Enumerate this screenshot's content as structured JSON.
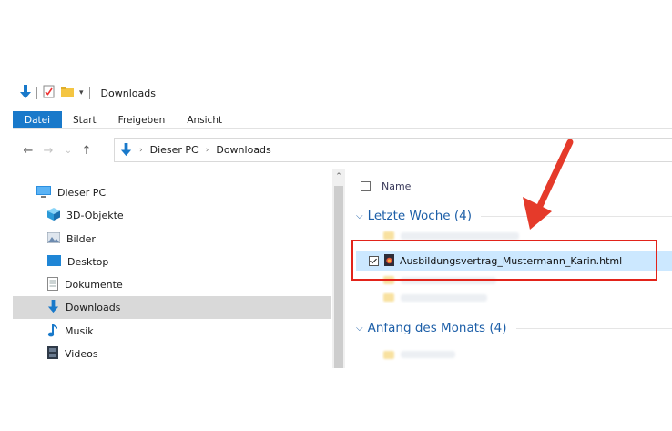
{
  "window": {
    "title": "Downloads"
  },
  "quick_access": {
    "icons": [
      "arrow-down-icon",
      "properties-icon",
      "new-folder-icon",
      "customize-dropdown-icon"
    ]
  },
  "ribbon": {
    "tabs": [
      {
        "label": "Datei",
        "active": true
      },
      {
        "label": "Start"
      },
      {
        "label": "Freigeben"
      },
      {
        "label": "Ansicht"
      }
    ]
  },
  "nav": {
    "back": "←",
    "forward": "→",
    "recent": "⌄",
    "up": "↑"
  },
  "address": {
    "crumbs": [
      "Dieser PC",
      "Downloads"
    ]
  },
  "sidebar": {
    "items": [
      {
        "label": "Dieser PC",
        "icon": "pc-icon"
      },
      {
        "label": "3D-Objekte",
        "icon": "cube-icon"
      },
      {
        "label": "Bilder",
        "icon": "pictures-icon"
      },
      {
        "label": "Desktop",
        "icon": "desktop-icon"
      },
      {
        "label": "Dokumente",
        "icon": "document-icon"
      },
      {
        "label": "Downloads",
        "icon": "download-icon",
        "selected": true
      },
      {
        "label": "Musik",
        "icon": "music-icon"
      },
      {
        "label": "Videos",
        "icon": "video-icon"
      }
    ]
  },
  "file_list": {
    "column_name": "Name",
    "groups": [
      {
        "label": "Letzte Woche (4)",
        "chevron": "⌵"
      },
      {
        "label": "Anfang des Monats (4)",
        "chevron": "⌵"
      }
    ],
    "selected_file": {
      "name": "Ausbildungsvertrag_Mustermann_Karin.html",
      "checked": true
    }
  },
  "colors": {
    "accent": "#1979ca",
    "highlight": "#e2231a",
    "selection": "#cce8ff",
    "group_text": "#1d5fa8"
  }
}
